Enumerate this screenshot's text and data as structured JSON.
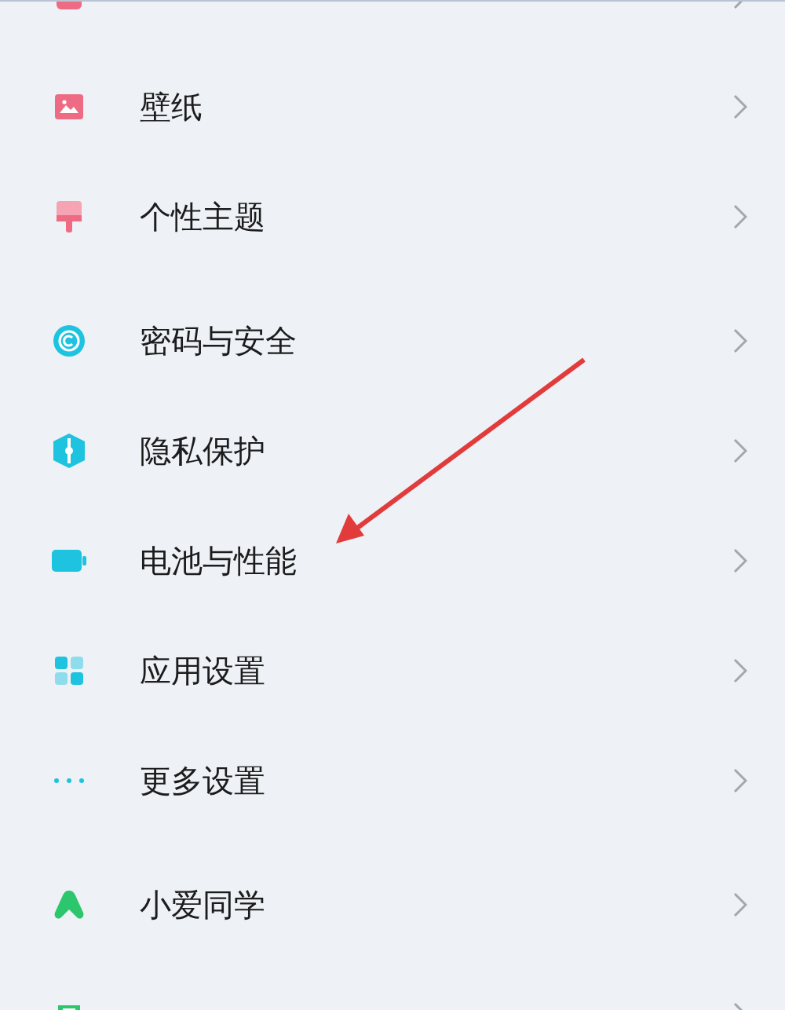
{
  "groups": [
    {
      "items": [
        {
          "kind": "desktop"
        },
        {
          "label": "壁纸",
          "kind": "wallpaper"
        },
        {
          "label": "个性主题",
          "kind": "theme"
        }
      ]
    },
    {
      "items": [
        {
          "label": "密码与安全",
          "kind": "security"
        },
        {
          "label": "隐私保护",
          "kind": "privacy"
        },
        {
          "label": "电池与性能",
          "kind": "battery"
        },
        {
          "label": "应用设置",
          "kind": "apps"
        },
        {
          "label": "更多设置",
          "kind": "more"
        }
      ]
    },
    {
      "items": [
        {
          "label": "小爱同学",
          "kind": "assistant"
        },
        {
          "kind": "screentime"
        }
      ]
    }
  ]
}
